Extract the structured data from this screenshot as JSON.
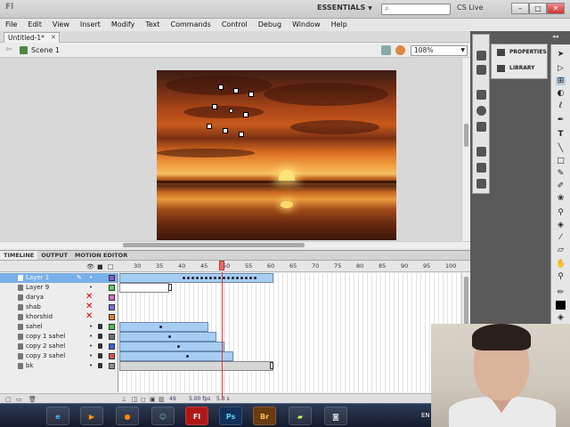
{
  "app": {
    "workspace": "ESSENTIALS",
    "search_placeholder": "",
    "cs_live": "CS Live",
    "window_buttons": [
      "–",
      "□",
      "✕"
    ]
  },
  "menu": [
    "File",
    "Edit",
    "View",
    "Insert",
    "Modify",
    "Text",
    "Commands",
    "Control",
    "Debug",
    "Window",
    "Help"
  ],
  "document_tab": "Untitled-1*",
  "editbar": {
    "scene": "Scene 1",
    "zoom": "108%"
  },
  "right_panel": {
    "properties": "PROPERTIES",
    "library": "LIBRARY"
  },
  "timeline": {
    "tabs": [
      "TIMELINE",
      "OUTPUT",
      "MOTION EDITOR"
    ],
    "ruler": [
      "30",
      "35",
      "40",
      "45",
      "50",
      "55",
      "60",
      "65",
      "70",
      "75",
      "80",
      "85",
      "90",
      "95",
      "100"
    ],
    "layers": [
      {
        "name": "Layer 1",
        "selected": true,
        "color": "#8a5cc8"
      },
      {
        "name": "Layer 9",
        "color": "#5ad05a"
      },
      {
        "name": "darya",
        "hidden": true,
        "color": "#d070d0"
      },
      {
        "name": "shab",
        "hidden": true,
        "color": "#7070e0"
      },
      {
        "name": "khorshid",
        "hidden": true,
        "color": "#e08030"
      },
      {
        "name": "sahel",
        "locked": true,
        "color": "#50c050"
      },
      {
        "name": "copy 1 sahel",
        "locked": true,
        "color": "#707070"
      },
      {
        "name": "copy 2 sahel",
        "locked": true,
        "color": "#4060d0"
      },
      {
        "name": "copy 3 sahel",
        "locked": true,
        "color": "#e05050"
      },
      {
        "name": "bk",
        "locked": true,
        "color": "#909090"
      }
    ],
    "footer": {
      "frame": "49",
      "fps": "5.00 fps",
      "time": "5.3 s"
    }
  },
  "taskbar": {
    "language": "EN"
  }
}
